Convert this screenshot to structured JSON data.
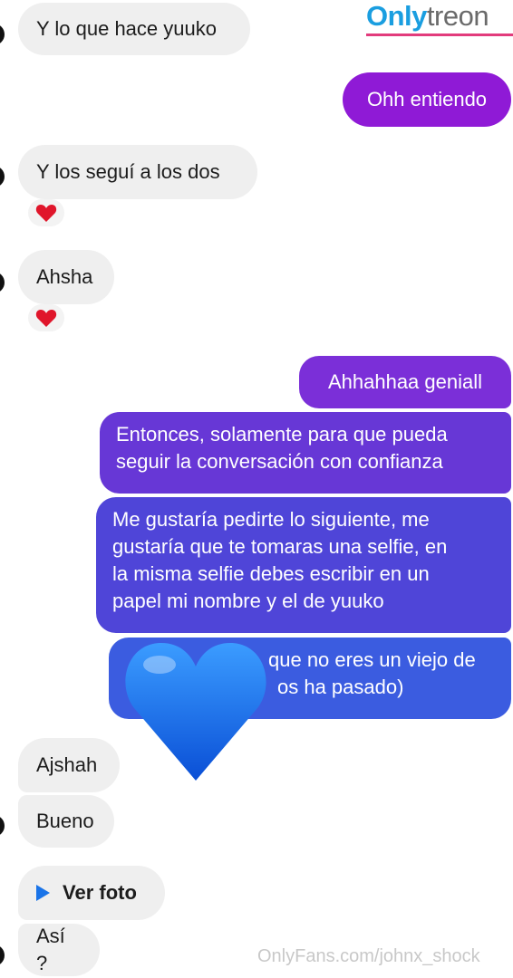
{
  "brand": {
    "logo_part1": "Only",
    "logo_part2": "treon",
    "watermark": "OnlyFans.com/johnx_shock"
  },
  "messages": [
    {
      "side": "received",
      "text": "Y lo que hace yuuko"
    },
    {
      "side": "sent",
      "text": "Ohh entiendo",
      "color": "#8f1ad6"
    },
    {
      "side": "received",
      "text": "Y los seguí a los dos",
      "reaction": "heart-icon"
    },
    {
      "side": "received",
      "text": "Ahsha",
      "reaction": "heart-icon"
    },
    {
      "side": "sent",
      "text": "Ahhahhaa geniall",
      "color": "#7b2fd8"
    },
    {
      "side": "sent",
      "line1": "Entonces, solamente para que pueda",
      "line2": "seguir la conversación con confianza",
      "color": "#6737d6"
    },
    {
      "side": "sent",
      "line1": "Me gustaría pedirte lo siguiente, me",
      "line2": "gustaría que te tomaras una selfie, en",
      "line3": "la misma selfie debes escribir en un",
      "line4": "papel mi nombre y el de yuuko",
      "color": "#4f45d8"
    },
    {
      "side": "sent",
      "line1": "que no eres un viejo de",
      "line2": "os ha pasado)",
      "color": "#3b5ce0",
      "sticker": "blue-heart-icon"
    },
    {
      "side": "received",
      "text": "Ajshah"
    },
    {
      "side": "received",
      "text": "Bueno"
    },
    {
      "side": "received",
      "text": "Ver foto",
      "icon": "play-icon"
    },
    {
      "side": "received",
      "text": "Así ?"
    }
  ],
  "colors": {
    "received_bubble": "#efefef",
    "heart": "#e0162b",
    "blue_heart": "#1a66e8"
  }
}
